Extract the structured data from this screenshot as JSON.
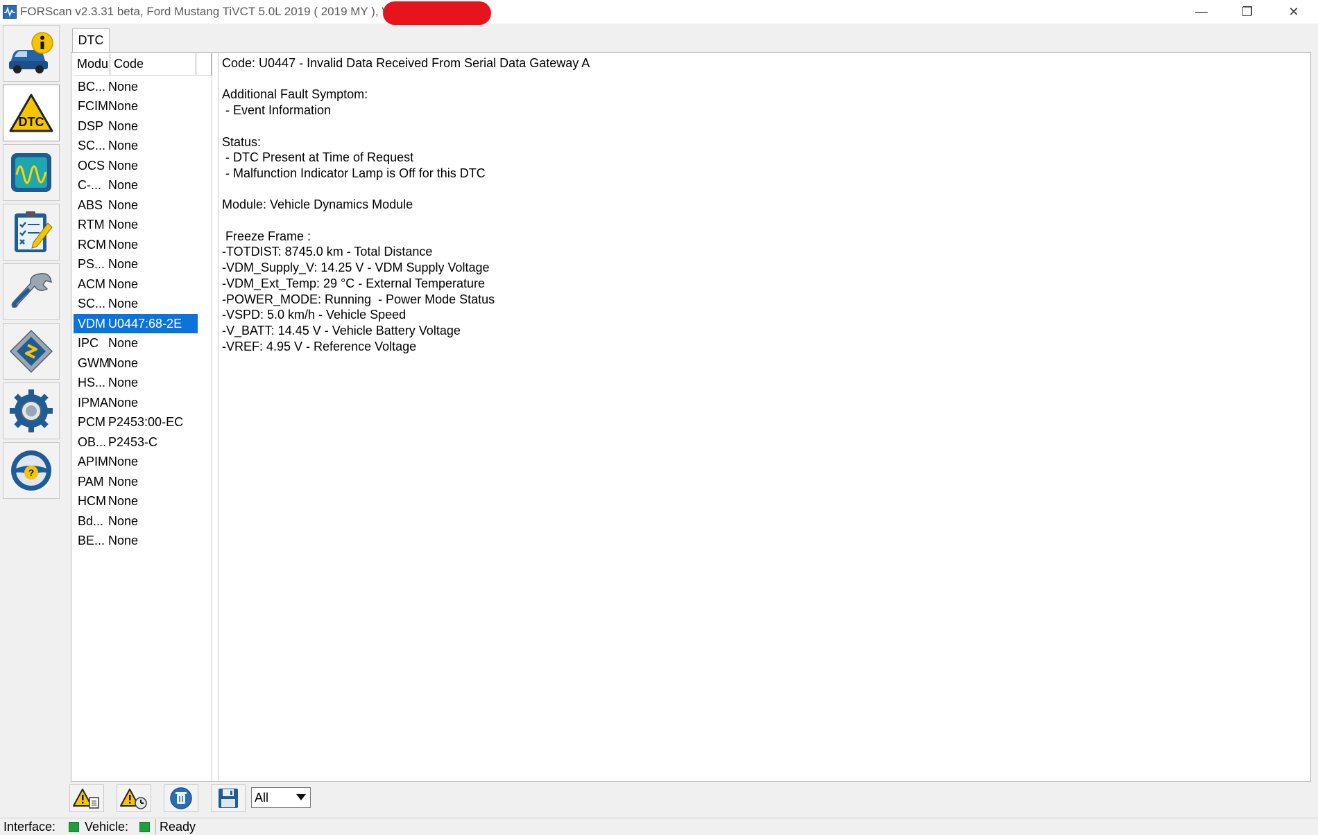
{
  "window": {
    "title": "FORScan v2.3.31 beta, Ford Mustang TiVCT 5.0L 2019 ( 2019 MY ), VIN",
    "minimize": "—",
    "restore": "❐",
    "close": "✕"
  },
  "nav": [
    {
      "name": "vehicle-info",
      "icon": "car-info-icon"
    },
    {
      "name": "dtc",
      "icon": "dtc-warning-icon"
    },
    {
      "name": "oscilloscope",
      "icon": "oscilloscope-icon"
    },
    {
      "name": "tests",
      "icon": "checklist-icon"
    },
    {
      "name": "service",
      "icon": "wrench-icon"
    },
    {
      "name": "configuration",
      "icon": "chip-icon"
    },
    {
      "name": "settings",
      "icon": "gear-icon"
    },
    {
      "name": "help",
      "icon": "help-steering-icon"
    }
  ],
  "tabs": {
    "dtc": "DTC"
  },
  "modules": {
    "col_module": "Modu",
    "col_code": "Code",
    "rows": [
      {
        "module": "BC...",
        "code": "None"
      },
      {
        "module": "FCIM",
        "code": "None"
      },
      {
        "module": "DSP",
        "code": "None"
      },
      {
        "module": "SC...",
        "code": "None"
      },
      {
        "module": "OCS",
        "code": "None"
      },
      {
        "module": "C-...",
        "code": "None"
      },
      {
        "module": "ABS",
        "code": "None"
      },
      {
        "module": "RTM",
        "code": "None"
      },
      {
        "module": "RCM",
        "code": "None"
      },
      {
        "module": "PS...",
        "code": "None"
      },
      {
        "module": "ACM",
        "code": "None"
      },
      {
        "module": "SC...",
        "code": "None"
      },
      {
        "module": "VDM",
        "code": "U0447:68-2E",
        "selected": true
      },
      {
        "module": "IPC",
        "code": "None"
      },
      {
        "module": "GWM",
        "code": "None"
      },
      {
        "module": "HS...",
        "code": "None"
      },
      {
        "module": "IPMA",
        "code": "None"
      },
      {
        "module": "PCM",
        "code": "P2453:00-EC"
      },
      {
        "module": "OB...",
        "code": "P2453-C"
      },
      {
        "module": "APIM",
        "code": "None"
      },
      {
        "module": "PAM",
        "code": "None"
      },
      {
        "module": "HCM",
        "code": "None"
      },
      {
        "module": "Bd...",
        "code": "None"
      },
      {
        "module": "BE...",
        "code": "None"
      }
    ]
  },
  "detail": {
    "lines": [
      "Code: U0447 - Invalid Data Received From Serial Data Gateway A",
      "",
      "Additional Fault Symptom:",
      " - Event Information",
      "",
      "Status:",
      " - DTC Present at Time of Request",
      " - Malfunction Indicator Lamp is Off for this DTC",
      "",
      "Module: Vehicle Dynamics Module",
      "",
      " Freeze Frame :",
      "-TOTDIST: 8745.0 km - Total Distance",
      "-VDM_Supply_V: 14.25 V - VDM Supply Voltage",
      "-VDM_Ext_Temp: 29 °C - External Temperature",
      "-POWER_MODE: Running  - Power Mode Status",
      "-VSPD: 5.0 km/h - Vehicle Speed",
      "-V_BATT: 14.45 V - Vehicle Battery Voltage",
      "-VREF: 4.95 V - Reference Voltage"
    ]
  },
  "toolbar": {
    "filter_value": "All",
    "buttons": [
      "read-dtc-icon",
      "clear-dtc-icon",
      "delete-icon",
      "save-icon"
    ]
  },
  "status": {
    "interface_label": "Interface:",
    "vehicle_label": "Vehicle:",
    "state": "Ready"
  },
  "colors": {
    "selection": "#0a74d8",
    "led_green": "#1f9e3a",
    "redaction": "#e8141b"
  }
}
